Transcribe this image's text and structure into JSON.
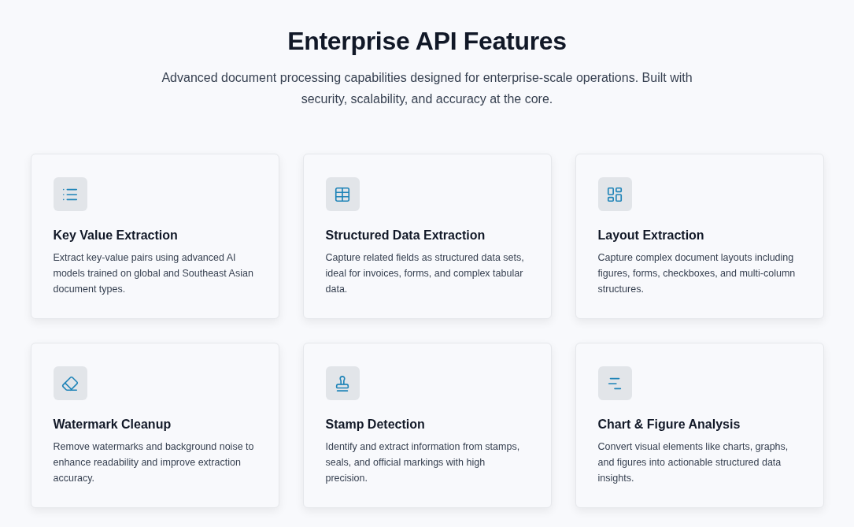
{
  "header": {
    "title": "Enterprise API Features",
    "subtitle": "Advanced document processing capabilities designed for enterprise-scale operations. Built with security, scalability, and accuracy at the core."
  },
  "features": [
    {
      "title": "Key Value Extraction",
      "description": "Extract key-value pairs using advanced AI models trained on global and Southeast Asian document types."
    },
    {
      "title": "Structured Data Extraction",
      "description": "Capture related fields as structured data sets, ideal for invoices, forms, and complex tabular data."
    },
    {
      "title": "Layout Extraction",
      "description": "Capture complex document layouts including figures, forms, checkboxes, and multi-column structures."
    },
    {
      "title": "Watermark Cleanup",
      "description": "Remove watermarks and background noise to enhance readability and improve extraction accuracy."
    },
    {
      "title": "Stamp Detection",
      "description": "Identify and extract information from stamps, seals, and official markings with high precision."
    },
    {
      "title": "Chart & Figure Analysis",
      "description": "Convert visual elements like charts, graphs, and figures into actionable structured data insights."
    }
  ]
}
